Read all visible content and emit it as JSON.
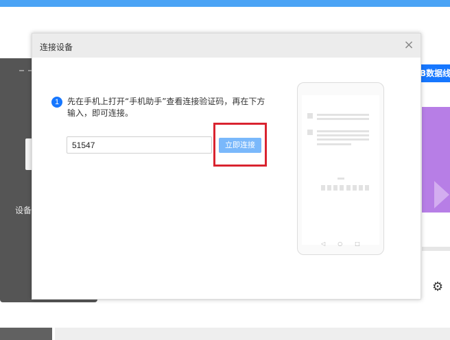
{
  "background": {
    "left_panel_label": "设备",
    "right_tab_label": "B数据线",
    "settings_icon": "gear-icon"
  },
  "dialog": {
    "title": "连接设备",
    "close_glyph": "×",
    "step_number": "1",
    "instruction": "先在手机上打开“手机助手”查看连接验证码，再在下方输入，即可连接。",
    "code_input_value": "51547",
    "connect_button_label": "立即连接",
    "highlight_color": "#d9232f",
    "accent_color": "#1677ff"
  },
  "phone_illustration": {
    "nav_back": "◁",
    "nav_home": "○",
    "nav_recent": "□"
  }
}
